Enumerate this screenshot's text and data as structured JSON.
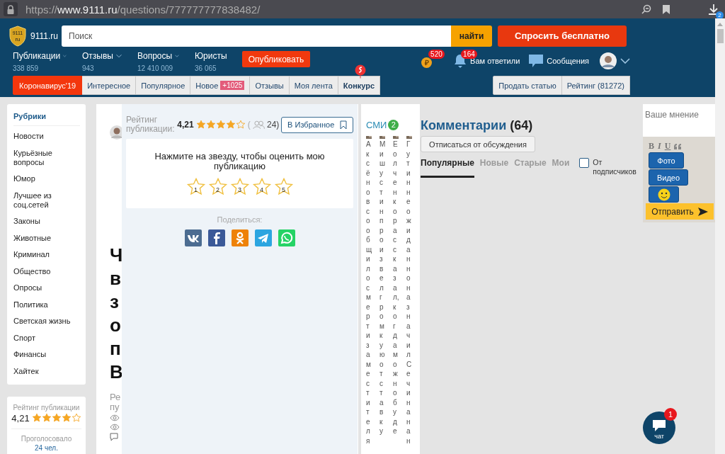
{
  "browser": {
    "url": {
      "scheme": "https://",
      "host": "www.9111.ru",
      "path": "/questions/777777777838482/"
    },
    "downloads_badge": "2"
  },
  "header": {
    "logo_mark": [
      "9111",
      "ru"
    ],
    "site_name": "9111.ru",
    "search": {
      "placeholder": "Поиск"
    },
    "search_button": "найти",
    "ask_button": "Спросить бесплатно",
    "nav": [
      {
        "label": "Публикации",
        "count": "338 859"
      },
      {
        "label": "Отзывы",
        "count": "943"
      },
      {
        "label": "Вопросы",
        "count": "12 410 009"
      },
      {
        "label": "Юристы",
        "count": "36 065"
      }
    ],
    "publish_button": "Опубликовать",
    "coins": {
      "symbol": "₽",
      "badge": "520"
    },
    "notifications": {
      "badge": "164",
      "label": "Вам ответили"
    },
    "messages": {
      "label": "Сообщения"
    },
    "tabs": [
      {
        "label": "Коронавирус'19",
        "kind": "promo"
      },
      {
        "label": "Интересное",
        "kind": "plain"
      },
      {
        "label": "Популярное",
        "kind": "plain"
      },
      {
        "label": "Новое",
        "kind": "counter",
        "badge": "+1025"
      },
      {
        "label": "Отзывы",
        "kind": "plain"
      },
      {
        "label": "Моя лента",
        "kind": "plain"
      },
      {
        "label": "Конкурс",
        "kind": "contest"
      }
    ],
    "right_tabs": [
      "Продать статью",
      "Рейтинг (81272)"
    ]
  },
  "sidebar": {
    "title": "Рубрики",
    "items": [
      "Новости",
      "Курьёзные вопросы",
      "Юмор",
      "Лучшее из соц.сетей",
      "Законы",
      "Животные",
      "Криминал",
      "Общество",
      "Опросы",
      "Политика",
      "Светская жизнь",
      "Спорт",
      "Финансы",
      "Хайтек"
    ]
  },
  "sidebar_rating": {
    "label": "Рейтинг публикации",
    "value": "4,21",
    "stars": 4,
    "voted_label": "Проголосовало",
    "voted_count": "24 чел."
  },
  "article": {
    "title_fragments": [
      "Ч",
      "в",
      "з",
      "о",
      "п",
      "В"
    ],
    "meta_fragments": [
      "Ре",
      "пу"
    ]
  },
  "rating_popup": {
    "label": "Рейтинг публикации:",
    "value": "4,21",
    "stars": 4,
    "open_paren": "(",
    "voters": "24)",
    "favorite_button": "В Избранное",
    "prompt": "Нажмите на звезду, чтобы оценить мою публикацию",
    "rate_stars": [
      "1",
      "2",
      "3",
      "4",
      "5"
    ],
    "share_label": "Поделиться:",
    "share": [
      {
        "kind": "vk",
        "color": "#4c6c91"
      },
      {
        "kind": "facebook",
        "color": "#3b5998"
      },
      {
        "kind": "ok",
        "color": "#ee8208"
      },
      {
        "kind": "telegram",
        "color": "#2ca5e0"
      },
      {
        "kind": "whatsapp",
        "color": "#25d366"
      }
    ]
  },
  "news": {
    "title": "СМИ",
    "badge": "2",
    "columns": [
      "Аксёновсообщилосмертизаместителя",
      "Мишустинпроизвелгромкуюотставку",
      "Еолченкорассказал,когдаможнобуде",
      "ГутиннеожиданноназначилСечинанан"
    ]
  },
  "comments": {
    "title": "Комментарии",
    "count": "(64)",
    "unsubscribe_button": "Отписаться от обсуждения",
    "sort_tabs": [
      {
        "label": "Популярные",
        "selected": true
      },
      {
        "label": "Новые",
        "selected": false
      },
      {
        "label": "Старые",
        "selected": false
      },
      {
        "label": "Мои",
        "selected": false
      }
    ],
    "subscribers_filter": {
      "label": "От подписчиков",
      "checked": false
    }
  },
  "comment_form": {
    "placeholder": "Ваше мнение",
    "format_buttons": [
      "B",
      "I",
      "U"
    ],
    "photo_button": "Фото",
    "video_button": "Видео",
    "send_button": "Отправить"
  },
  "chat": {
    "badge": "1",
    "label": "чат"
  }
}
